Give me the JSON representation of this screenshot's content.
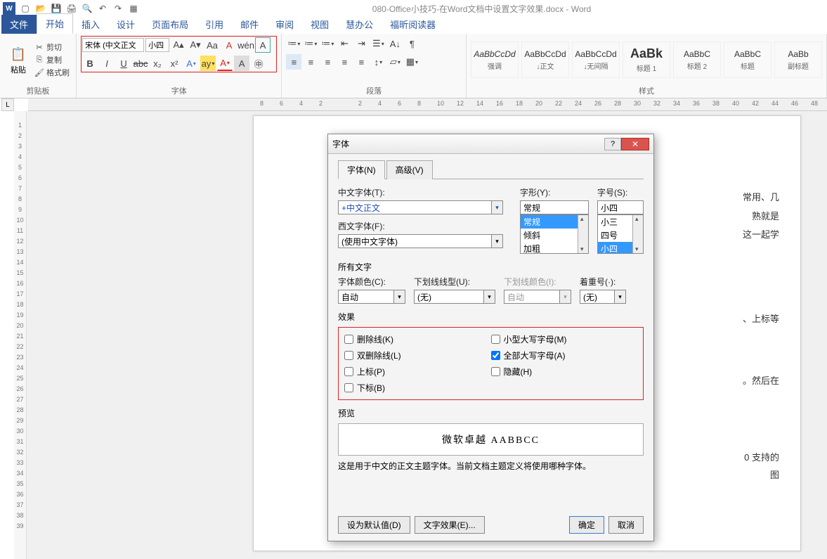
{
  "title": "080-Office小技巧-在Word文档中设置文字效果.docx - Word",
  "tabs": [
    "文件",
    "开始",
    "插入",
    "设计",
    "页面布局",
    "引用",
    "邮件",
    "审阅",
    "视图",
    "慧办公",
    "福昕阅读器"
  ],
  "active_tab_index": 1,
  "clipboard": {
    "paste": "粘贴",
    "cut": "剪切",
    "copy": "复制",
    "format_painter": "格式刷",
    "label": "剪贴板"
  },
  "font_group": {
    "font_name": "宋体 (中文正文",
    "font_size": "小四",
    "label": "字体",
    "row1_icons": [
      "A",
      "A",
      "Aa",
      "A",
      "wén",
      "A"
    ],
    "row2_icons": [
      "B",
      "I",
      "U",
      "abc",
      "x₂",
      "x²",
      "A",
      "ay",
      "A",
      "A",
      "字"
    ]
  },
  "para_group": {
    "label": "段落"
  },
  "styles_group": {
    "label": "样式",
    "items": [
      {
        "preview": "AaBbCcDd",
        "name": "强调",
        "italic": true
      },
      {
        "preview": "AaBbCcDd",
        "name": "↓正文"
      },
      {
        "preview": "AaBbCcDd",
        "name": "↓无间隔"
      },
      {
        "preview": "AaBk",
        "name": "标题 1",
        "big": true
      },
      {
        "preview": "AaBbC",
        "name": "标题 2"
      },
      {
        "preview": "AaBbC",
        "name": "标题"
      },
      {
        "preview": "AaBb",
        "name": "副标题"
      }
    ]
  },
  "ruler_h": [
    "8",
    "6",
    "4",
    "2",
    "",
    "2",
    "4",
    "6",
    "8",
    "10",
    "12",
    "14",
    "16",
    "18",
    "20",
    "22",
    "24",
    "26",
    "28",
    "30",
    "32",
    "34",
    "36",
    "38",
    "40",
    "42",
    "44",
    "46",
    "48"
  ],
  "ruler_v": [
    "",
    "1",
    "2",
    "3",
    "4",
    "5",
    "6",
    "7",
    "8",
    "9",
    "10",
    "11",
    "12",
    "13",
    "14",
    "15",
    "16",
    "17",
    "18",
    "19",
    "20",
    "21",
    "22",
    "23",
    "24",
    "25",
    "26",
    "27",
    "28",
    "29",
    "30",
    "31",
    "32",
    "33",
    "34",
    "35",
    "36",
    "37",
    "38",
    "39"
  ],
  "page_text": [
    "常用、几",
    "熟就是",
    "这一起学",
    "、上标等",
    "。然后在",
    "0 支持的",
    "图"
  ],
  "dialog": {
    "title": "字体",
    "tabs": [
      "字体(N)",
      "高级(V)"
    ],
    "cn_font_label": "中文字体(T):",
    "cn_font_value": "+中文正文",
    "style_label": "字形(Y):",
    "style_value": "常规",
    "style_list": [
      "常规",
      "倾斜",
      "加粗"
    ],
    "size_label": "字号(S):",
    "size_value": "小四",
    "size_list": [
      "小三",
      "四号",
      "小四"
    ],
    "west_font_label": "西文字体(F):",
    "west_font_value": "(使用中文字体)",
    "all_text": "所有文字",
    "color_label": "字体颜色(C):",
    "color_value": "自动",
    "underline_label": "下划线线型(U):",
    "underline_value": "(无)",
    "underline_color_label": "下划线颜色(I):",
    "underline_color_value": "自动",
    "emphasis_label": "着重号(·):",
    "emphasis_value": "(无)",
    "effects_label": "效果",
    "effects_left": [
      "删除线(K)",
      "双删除线(L)",
      "上标(P)",
      "下标(B)"
    ],
    "effects_right": [
      "小型大写字母(M)",
      "全部大写字母(A)",
      "隐藏(H)"
    ],
    "checked_effect": "全部大写字母(A)",
    "preview_label": "预览",
    "preview_text": "微软卓越   AABBCC",
    "preview_desc": "这是用于中文的正文主题字体。当前文档主题定义将使用哪种字体。",
    "btn_default": "设为默认值(D)",
    "btn_effects": "文字效果(E)...",
    "btn_ok": "确定",
    "btn_cancel": "取消"
  }
}
